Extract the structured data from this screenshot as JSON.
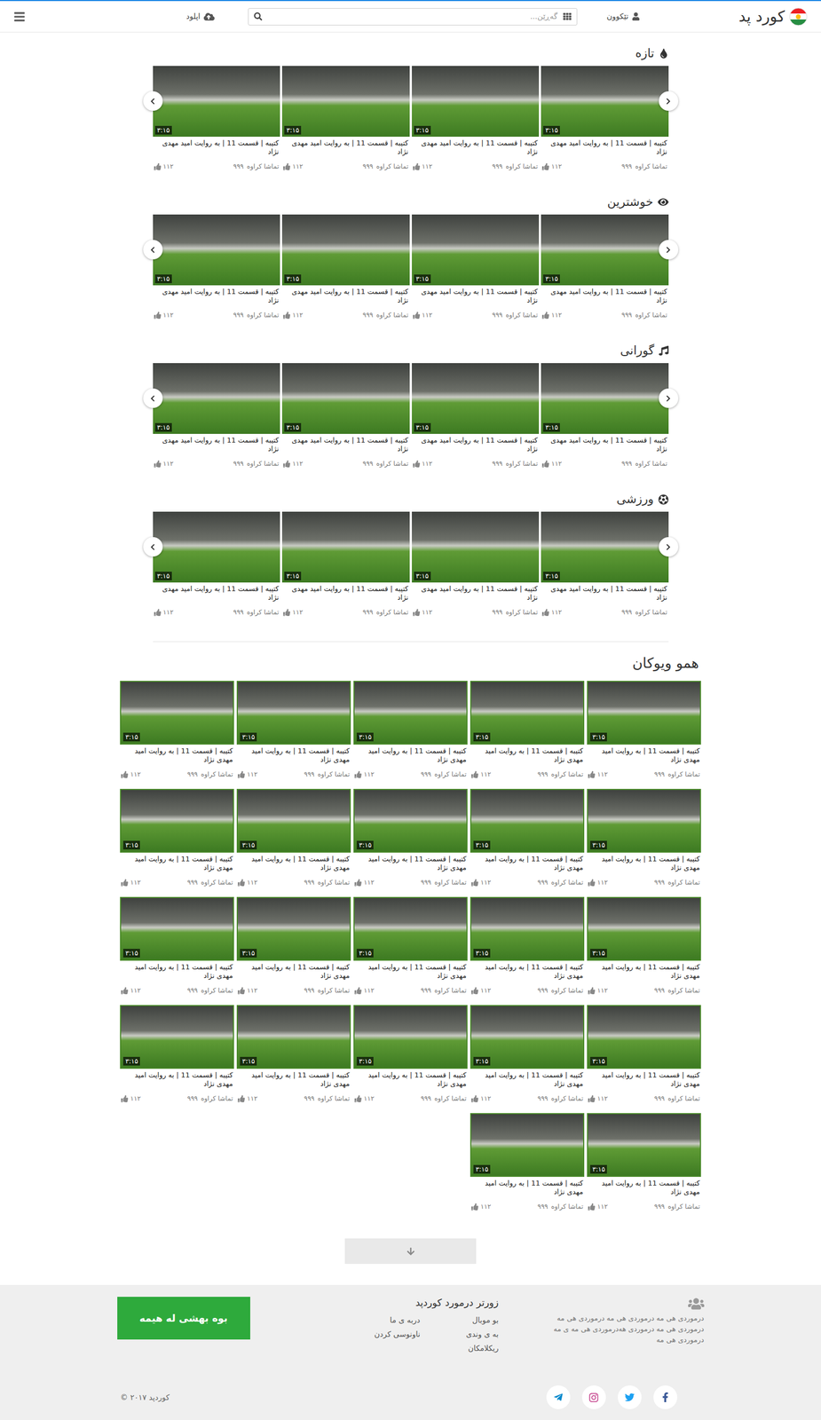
{
  "header": {
    "logo": "کورد پد",
    "login": "تێکوون",
    "search": {
      "placeholder": "گەڕێن..."
    },
    "upload": "اپلود"
  },
  "sections": [
    {
      "title": "تازه",
      "kind": "new",
      "cards": [
        {
          "title": "کتیبه | قسمت 11 | به روایت امید مهدی نژاد",
          "duration": "۳:۱۵",
          "views_label": "تماشا کراوە",
          "views": "۹۹۹",
          "likes": "۱۱۲"
        },
        {
          "title": "کتیبه | قسمت 11 | به روایت امید مهدی نژاد",
          "duration": "۳:۱۵",
          "views_label": "تماشا کراوە",
          "views": "۹۹۹",
          "likes": "۱۱۲"
        },
        {
          "title": "کتیبه | قسمت 11 | به روایت امید مهدی نژاد",
          "duration": "۳:۱۵",
          "views_label": "تماشا کراوە",
          "views": "۹۹۹",
          "likes": "۱۱۲"
        },
        {
          "title": "کتیبه | قسمت 11 | به روایت امید مهدی نژاد",
          "duration": "۳:۱۵",
          "views_label": "تماشا کراوە",
          "views": "۹۹۹",
          "likes": "۱۱۲"
        }
      ]
    },
    {
      "title": "خوشترین",
      "kind": "popular",
      "cards": [
        {
          "title": "کتیبه | قسمت 11 | به روایت امید مهدی نژاد",
          "duration": "۳:۱۵",
          "views_label": "تماشا کراوە",
          "views": "۹۹۹",
          "likes": "۱۱۲"
        },
        {
          "title": "کتیبه | قسمت 11 | به روایت امید مهدی نژاد",
          "duration": "۳:۱۵",
          "views_label": "تماشا کراوە",
          "views": "۹۹۹",
          "likes": "۱۱۲"
        },
        {
          "title": "کتیبه | قسمت 11 | به روایت امید مهدی نژاد",
          "duration": "۳:۱۵",
          "views_label": "تماشا کراوە",
          "views": "۹۹۹",
          "likes": "۱۱۲"
        },
        {
          "title": "کتیبه | قسمت 11 | به روایت امید مهدی نژاد",
          "duration": "۳:۱۵",
          "views_label": "تماشا کراوە",
          "views": "۹۹۹",
          "likes": "۱۱۲"
        }
      ]
    },
    {
      "title": "گورانی",
      "kind": "music",
      "cards": [
        {
          "title": "کتیبه | قسمت 11 | به روایت امید مهدی نژاد",
          "duration": "۳:۱۵",
          "views_label": "تماشا کراوە",
          "views": "۹۹۹",
          "likes": "۱۱۲"
        },
        {
          "title": "کتیبه | قسمت 11 | به روایت امید مهدی نژاد",
          "duration": "۳:۱۵",
          "views_label": "تماشا کراوە",
          "views": "۹۹۹",
          "likes": "۱۱۲"
        },
        {
          "title": "کتیبه | قسمت 11 | به روایت امید مهدی نژاد",
          "duration": "۳:۱۵",
          "views_label": "تماشا کراوە",
          "views": "۹۹۹",
          "likes": "۱۱۲"
        },
        {
          "title": "کتیبه | قسمت 11 | به روایت امید مهدی نژاد",
          "duration": "۳:۱۵",
          "views_label": "تماشا کراوە",
          "views": "۹۹۹",
          "likes": "۱۱۲"
        }
      ]
    },
    {
      "title": "ورزشی",
      "kind": "sport",
      "cards": [
        {
          "title": "کتیبه | قسمت 11 | به روایت امید مهدی نژاد",
          "duration": "۳:۱۵",
          "views_label": "تماشا کراوە",
          "views": "۹۹۹",
          "likes": "۱۱۲"
        },
        {
          "title": "کتیبه | قسمت 11 | به روایت امید مهدی نژاد",
          "duration": "۳:۱۵",
          "views_label": "تماشا کراوە",
          "views": "۹۹۹",
          "likes": "۱۱۲"
        },
        {
          "title": "کتیبه | قسمت 11 | به روایت امید مهدی نژاد",
          "duration": "۳:۱۵",
          "views_label": "تماشا کراوە",
          "views": "۹۹۹",
          "likes": "۱۱۲"
        },
        {
          "title": "کتیبه | قسمت 11 | به روایت امید مهدی نژاد",
          "duration": "۳:۱۵",
          "views_label": "تماشا کراوە",
          "views": "۹۹۹",
          "likes": "۱۱۲"
        }
      ]
    }
  ],
  "all_videos": {
    "title": "همو ویوکان",
    "cards": [
      {
        "title": "کتیبه | قسمت 11 | به روایت امید مهدی نژاد",
        "duration": "۳:۱۵",
        "views_label": "تماشا کراوە",
        "views": "۹۹۹",
        "likes": "۱۱۲"
      },
      {
        "title": "کتیبه | قسمت 11 | به روایت امید مهدی نژاد",
        "duration": "۳:۱۵",
        "views_label": "تماشا کراوە",
        "views": "۹۹۹",
        "likes": "۱۱۲"
      },
      {
        "title": "کتیبه | قسمت 11 | به روایت امید مهدی نژاد",
        "duration": "۳:۱۵",
        "views_label": "تماشا کراوە",
        "views": "۹۹۹",
        "likes": "۱۱۲"
      },
      {
        "title": "کتیبه | قسمت 11 | به روایت امید مهدی نژاد",
        "duration": "۳:۱۵",
        "views_label": "تماشا کراوە",
        "views": "۹۹۹",
        "likes": "۱۱۲"
      },
      {
        "title": "کتیبه | قسمت 11 | به روایت امید مهدی نژاد",
        "duration": "۳:۱۵",
        "views_label": "تماشا کراوە",
        "views": "۹۹۹",
        "likes": "۱۱۲"
      },
      {
        "title": "کتیبه | قسمت 11 | به روایت امید مهدی نژاد",
        "duration": "۳:۱۵",
        "views_label": "تماشا کراوە",
        "views": "۹۹۹",
        "likes": "۱۱۲"
      },
      {
        "title": "کتیبه | قسمت 11 | به روایت امید مهدی نژاد",
        "duration": "۳:۱۵",
        "views_label": "تماشا کراوە",
        "views": "۹۹۹",
        "likes": "۱۱۲"
      },
      {
        "title": "کتیبه | قسمت 11 | به روایت امید مهدی نژاد",
        "duration": "۳:۱۵",
        "views_label": "تماشا کراوە",
        "views": "۹۹۹",
        "likes": "۱۱۲"
      },
      {
        "title": "کتیبه | قسمت 11 | به روایت امید مهدی نژاد",
        "duration": "۳:۱۵",
        "views_label": "تماشا کراوە",
        "views": "۹۹۹",
        "likes": "۱۱۲"
      },
      {
        "title": "کتیبه | قسمت 11 | به روایت امید مهدی نژاد",
        "duration": "۳:۱۵",
        "views_label": "تماشا کراوە",
        "views": "۹۹۹",
        "likes": "۱۱۲"
      },
      {
        "title": "کتیبه | قسمت 11 | به روایت امید مهدی نژاد",
        "duration": "۳:۱۵",
        "views_label": "تماشا کراوە",
        "views": "۹۹۹",
        "likes": "۱۱۲"
      },
      {
        "title": "کتیبه | قسمت 11 | به روایت امید مهدی نژاد",
        "duration": "۳:۱۵",
        "views_label": "تماشا کراوە",
        "views": "۹۹۹",
        "likes": "۱۱۲"
      },
      {
        "title": "کتیبه | قسمت 11 | به روایت امید مهدی نژاد",
        "duration": "۳:۱۵",
        "views_label": "تماشا کراوە",
        "views": "۹۹۹",
        "likes": "۱۱۲"
      },
      {
        "title": "کتیبه | قسمت 11 | به روایت امید مهدی نژاد",
        "duration": "۳:۱۵",
        "views_label": "تماشا کراوە",
        "views": "۹۹۹",
        "likes": "۱۱۲"
      },
      {
        "title": "کتیبه | قسمت 11 | به روایت امید مهدی نژاد",
        "duration": "۳:۱۵",
        "views_label": "تماشا کراوە",
        "views": "۹۹۹",
        "likes": "۱۱۲"
      },
      {
        "title": "کتیبه | قسمت 11 | به روایت امید مهدی نژاد",
        "duration": "۳:۱۵",
        "views_label": "تماشا کراوە",
        "views": "۹۹۹",
        "likes": "۱۱۲"
      },
      {
        "title": "کتیبه | قسمت 11 | به روایت امید مهدی نژاد",
        "duration": "۳:۱۵",
        "views_label": "تماشا کراوە",
        "views": "۹۹۹",
        "likes": "۱۱۲"
      },
      {
        "title": "کتیبه | قسمت 11 | به روایت امید مهدی نژاد",
        "duration": "۳:۱۵",
        "views_label": "تماشا کراوە",
        "views": "۹۹۹",
        "likes": "۱۱۲"
      },
      {
        "title": "کتیبه | قسمت 11 | به روایت امید مهدی نژاد",
        "duration": "۳:۱۵",
        "views_label": "تماشا کراوە",
        "views": "۹۹۹",
        "likes": "۱۱۲"
      },
      {
        "title": "کتیبه | قسمت 11 | به روایت امید مهدی نژاد",
        "duration": "۳:۱۵",
        "views_label": "تماشا کراوە",
        "views": "۹۹۹",
        "likes": "۱۱۲"
      },
      {
        "title": "کتیبه | قسمت 11 | به روایت امید مهدی نژاد",
        "duration": "۳:۱۵",
        "views_label": "تماشا کراوە",
        "views": "۹۹۹",
        "likes": "۱۱۲"
      },
      {
        "title": "کتیبه | قسمت 11 | به روایت امید مهدی نژاد",
        "duration": "۳:۱۵",
        "views_label": "تماشا کراوە",
        "views": "۹۹۹",
        "likes": "۱۱۲"
      }
    ]
  },
  "footer": {
    "about": "درموردی هی مە درموردی هی مە درموردی هی مە درموردی هی مە درموردی هەدرموردی هی مە ی مە درموردی هی مە",
    "links_title": "زورتر درمورد کوردپد",
    "links_right": [
      "بو موبال",
      "به ی وندی",
      "ریکلامکان"
    ],
    "links_left": [
      "دربه ی ما",
      "ناونوسی کردن"
    ],
    "join_button": "بوە بهشی لە هیمە",
    "copyright": "کوردپد ۲۰۱۷ ©"
  }
}
